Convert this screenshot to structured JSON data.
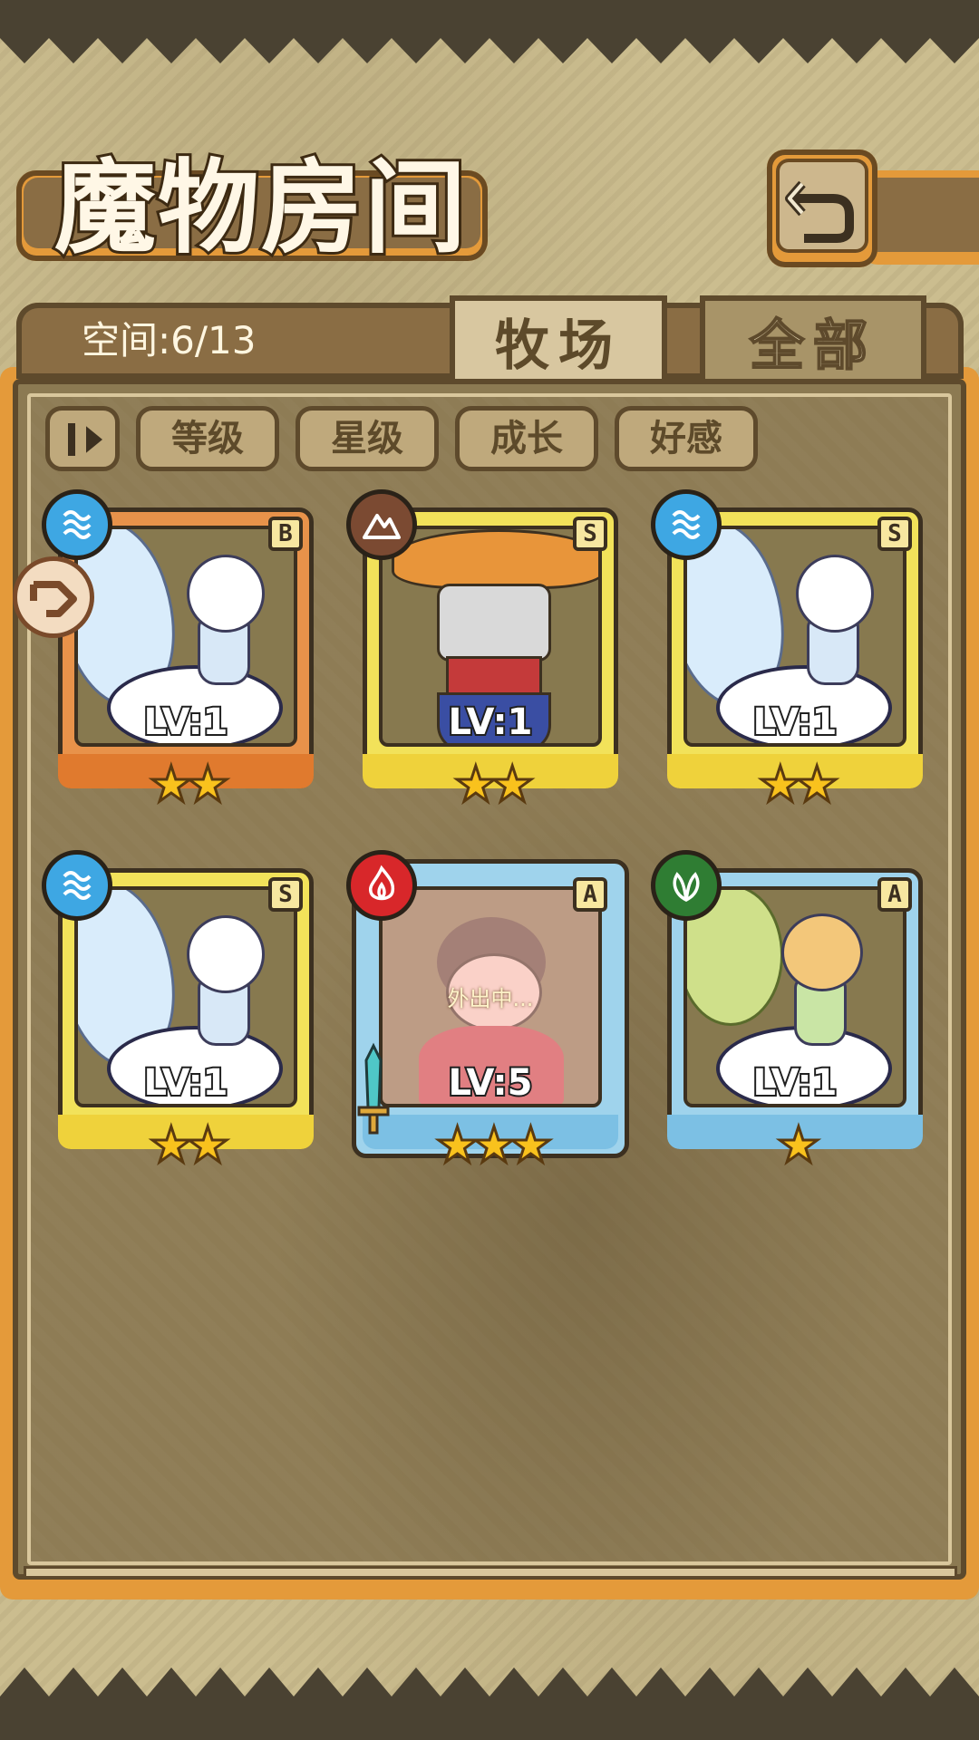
{
  "header": {
    "title": "魔物房间",
    "back_icon": "return-arrow-icon"
  },
  "panel": {
    "capacity_label": "空间:6/13",
    "tabs": [
      {
        "label": "牧场",
        "active": true
      },
      {
        "label": "全部",
        "active": false
      }
    ],
    "filters": [
      {
        "label": "等级"
      },
      {
        "label": "星级"
      },
      {
        "label": "成长"
      },
      {
        "label": "好感"
      }
    ]
  },
  "monsters": [
    {
      "grade": "B",
      "element": "water",
      "level": "LV:1",
      "stars": "★★",
      "rarity_color": "#e8924a",
      "away": false
    },
    {
      "grade": "S",
      "element": "earth",
      "level": "LV:1",
      "stars": "★★",
      "rarity_color": "#f2e25a",
      "away": false
    },
    {
      "grade": "S",
      "element": "water",
      "level": "LV:1",
      "stars": "★★",
      "rarity_color": "#f2e25a",
      "away": false
    },
    {
      "grade": "S",
      "element": "water",
      "level": "LV:1",
      "stars": "★★",
      "rarity_color": "#f2e25a",
      "away": false
    },
    {
      "grade": "A",
      "element": "fire",
      "level": "LV:5",
      "stars": "★★★",
      "rarity_color": "#9fd3ec",
      "away": true,
      "status": "外出中..."
    },
    {
      "grade": "A",
      "element": "wood",
      "level": "LV:1",
      "stars": "★",
      "rarity_color": "#9fd3ec",
      "away": false
    }
  ],
  "colors": {
    "frame_orange": "#e49a3a",
    "panel_brown": "#8e7c55",
    "star_gold": "#f9c21d"
  }
}
